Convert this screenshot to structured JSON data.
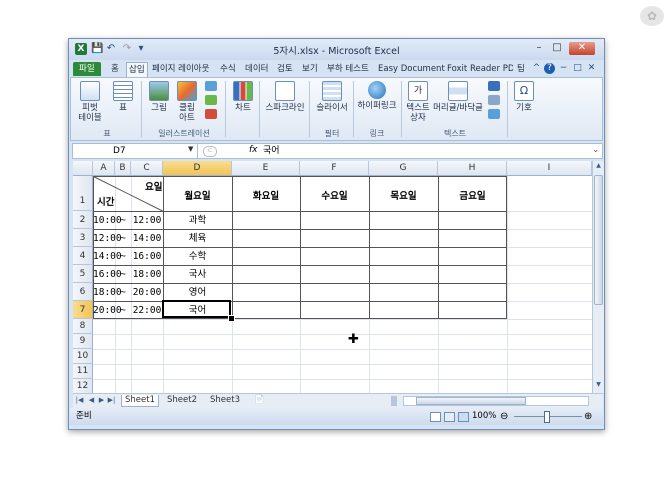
{
  "title_bar": {
    "title": "5자시.xlsx  -  Microsoft Excel",
    "icon": "X",
    "qa_save": "💾",
    "qa_undo": "↶",
    "qa_redo": "↷",
    "qa_more": "▾",
    "minimize": "–",
    "restore": "□",
    "close": "✕"
  },
  "ribbon_tabs": {
    "file": "파일",
    "items": [
      "홈",
      "삽입",
      "페이지 레이아웃",
      "수식",
      "데이터",
      "검토",
      "보기",
      "부하 테스트",
      "Easy Document",
      "Foxit Reader PDF",
      "팀"
    ],
    "right_icons": [
      "^",
      "?",
      "−",
      "□",
      "✕"
    ]
  },
  "ribbon": {
    "pivot_label": "피벗\n테이블",
    "table_label": "표",
    "picture_label": "그림",
    "clipart_label": "클립\n아트",
    "chart_label": "차트",
    "sparkline_label": "스파크라인",
    "slicer_label": "슬라이서",
    "hyperlink_label": "하이퍼링크",
    "textbox_label": "텍스트\n상자",
    "headerfooter_label": "머리글/바닥글",
    "symbol_label": "기호",
    "groups": {
      "table": "표",
      "illustrations": "일러스트레이션",
      "filter": "필터",
      "link": "링크",
      "text": "텍스트"
    }
  },
  "formula_bar": {
    "name_box": "D7",
    "fx": "fx",
    "value": "국어"
  },
  "grid": {
    "columns": [
      "A",
      "B",
      "C",
      "D",
      "E",
      "F",
      "G",
      "H",
      "I"
    ],
    "rows": [
      "1",
      "2",
      "3",
      "4",
      "5",
      "6",
      "7",
      "8",
      "9",
      "10",
      "11",
      "12"
    ],
    "header_time": "시간",
    "header_day": "요일",
    "day_headers": [
      "월요일",
      "화요일",
      "수요일",
      "목요일",
      "금요일"
    ],
    "times": [
      {
        "start": "10:00",
        "sep": "~",
        "end": "12:00",
        "subject": "과학"
      },
      {
        "start": "12:00",
        "sep": "~",
        "end": "14:00",
        "subject": "체육"
      },
      {
        "start": "14:00",
        "sep": "~",
        "end": "16:00",
        "subject": "수학"
      },
      {
        "start": "16:00",
        "sep": "~",
        "end": "18:00",
        "subject": "국사"
      },
      {
        "start": "18:00",
        "sep": "~",
        "end": "20:00",
        "subject": "영어"
      },
      {
        "start": "20:00",
        "sep": "~",
        "end": "22:00",
        "subject": "국어"
      }
    ]
  },
  "sheets": {
    "tabs": [
      "Sheet1",
      "Sheet2",
      "Sheet3"
    ],
    "active": "Sheet1"
  },
  "status_bar": {
    "ready": "준비",
    "zoom": "100%",
    "minus": "⊖",
    "plus": "⊕"
  }
}
